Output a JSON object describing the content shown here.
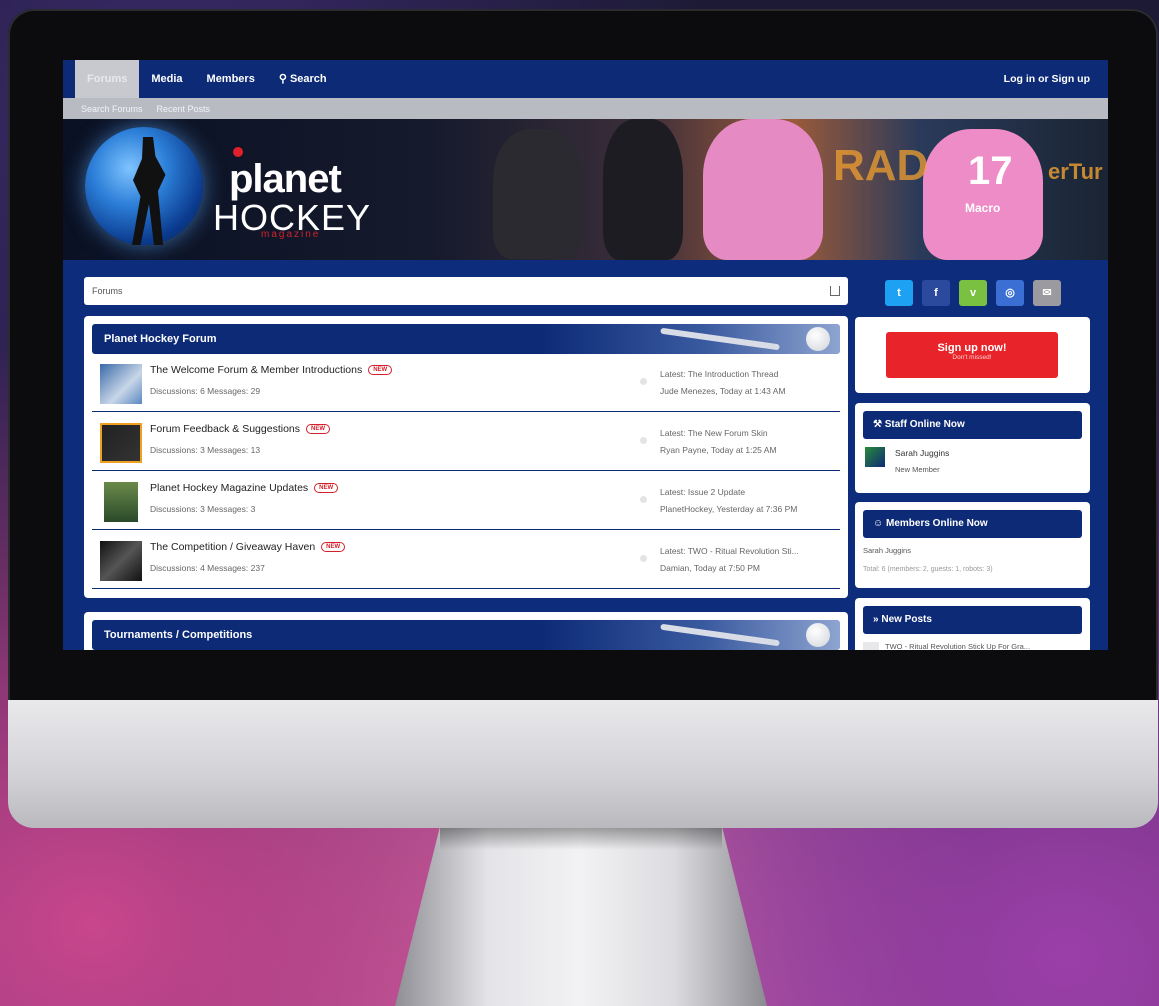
{
  "nav": {
    "tabs": [
      "Forums",
      "Media",
      "Members",
      "Search"
    ],
    "login": "Log in or Sign up",
    "sub_links": [
      "Search Forums",
      "Recent Posts"
    ]
  },
  "banner": {
    "logo_top": "planet",
    "logo_bottom": "HOCKEY",
    "logo_sub": "magazine",
    "jersey_number": "17",
    "jersey_brand": "Macro",
    "ad_text_1": "RAD",
    "ad_text_2": "erTur"
  },
  "breadcrumb": "Forums",
  "category1": {
    "title": "Planet Hockey Forum",
    "new_label": "NEW",
    "nodes": [
      {
        "title": "The Welcome Forum & Member Introductions",
        "stats": "Discussions: 6   Messages: 29",
        "latest": "Latest: The Introduction Thread",
        "by": "Jude Menezes, Today at 1:43 AM"
      },
      {
        "title": "Forum Feedback & Suggestions",
        "stats": "Discussions: 3   Messages: 13",
        "latest": "Latest: The New Forum Skin",
        "by": "Ryan Payne, Today at 1:25 AM"
      },
      {
        "title": "Planet Hockey Magazine Updates",
        "stats": "Discussions: 3   Messages: 3",
        "latest": "Latest: Issue 2 Update",
        "by": "PlanetHockey, Yesterday at 7:36 PM"
      },
      {
        "title": "The Competition / Giveaway Haven",
        "stats": "Discussions: 4   Messages: 237",
        "latest": "Latest: TWO - Ritual Revolution Sti...",
        "by": "Damian, Today at 7:50 PM"
      }
    ]
  },
  "category2": {
    "title": "Tournaments / Competitions"
  },
  "sidebar": {
    "social": [
      "twitter-icon",
      "facebook-icon",
      "vimeo-icon",
      "instagram-icon",
      "mail-icon"
    ],
    "social_colors": [
      "#1da1f2",
      "#2b4a9e",
      "#7ac142",
      "#3b6fd4",
      "#9a9aa0"
    ],
    "signup_main": "Sign up now!",
    "signup_sub": "Don't missed!",
    "staff_title": "Staff Online Now",
    "staff_name": "Sarah Juggins",
    "staff_role": "New Member",
    "members_title": "Members Online Now",
    "members_name": "Sarah Juggins",
    "members_total": "Total: 6 (members: 2, guests: 1, robots: 3)",
    "newposts_title": "New Posts",
    "newposts_item": "TWO - Ritual Revolution Stick Up For Gra..."
  }
}
